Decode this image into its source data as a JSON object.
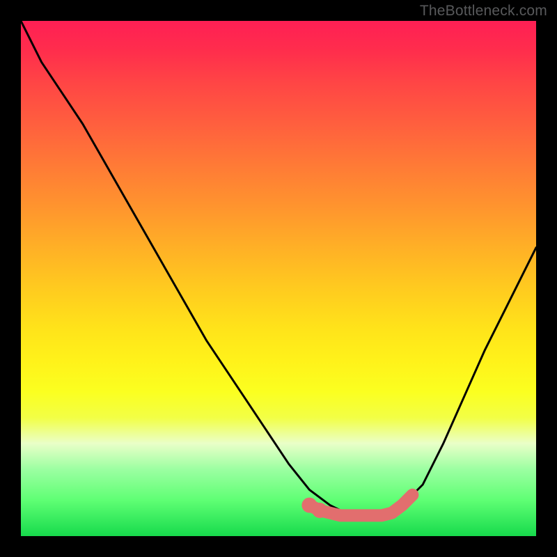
{
  "watermark": "TheBottleneck.com",
  "chart_data": {
    "type": "line",
    "title": "",
    "xlabel": "",
    "ylabel": "",
    "xlim": [
      0,
      100
    ],
    "ylim": [
      0,
      100
    ],
    "series": [
      {
        "name": "black-curve",
        "color": "#000000",
        "x": [
          0,
          2,
          4,
          8,
          12,
          16,
          20,
          24,
          28,
          32,
          36,
          40,
          44,
          48,
          52,
          56,
          60,
          62,
          64,
          66,
          70,
          74,
          78,
          82,
          86,
          90,
          94,
          98,
          100
        ],
        "y": [
          100,
          96,
          92,
          86,
          80,
          73,
          66,
          59,
          52,
          45,
          38,
          32,
          26,
          20,
          14,
          9,
          6,
          5,
          4,
          4,
          4,
          6,
          10,
          18,
          27,
          36,
          44,
          52,
          56
        ]
      },
      {
        "name": "pink-floor",
        "color": "#e26e6e",
        "x": [
          56,
          58,
          60,
          62,
          64,
          66,
          68,
          70,
          72,
          74,
          76
        ],
        "y": [
          6,
          5,
          4.5,
          4,
          4,
          4,
          4,
          4,
          4.5,
          6,
          8
        ]
      }
    ],
    "gradient_bands": [
      {
        "pos": 0.0,
        "color": "#ff1f54"
      },
      {
        "pos": 0.06,
        "color": "#ff2e4c"
      },
      {
        "pos": 0.12,
        "color": "#ff4545"
      },
      {
        "pos": 0.2,
        "color": "#ff5f3e"
      },
      {
        "pos": 0.28,
        "color": "#ff7a36"
      },
      {
        "pos": 0.36,
        "color": "#ff942e"
      },
      {
        "pos": 0.44,
        "color": "#ffb026"
      },
      {
        "pos": 0.52,
        "color": "#ffcb1f"
      },
      {
        "pos": 0.6,
        "color": "#ffe41a"
      },
      {
        "pos": 0.66,
        "color": "#fff21a"
      },
      {
        "pos": 0.72,
        "color": "#fbff20"
      },
      {
        "pos": 0.77,
        "color": "#f2ff45"
      },
      {
        "pos": 0.82,
        "color": "#eaffc8"
      },
      {
        "pos": 0.87,
        "color": "#9cffa2"
      },
      {
        "pos": 0.93,
        "color": "#5fff74"
      },
      {
        "pos": 1.0,
        "color": "#17da4c"
      }
    ]
  }
}
